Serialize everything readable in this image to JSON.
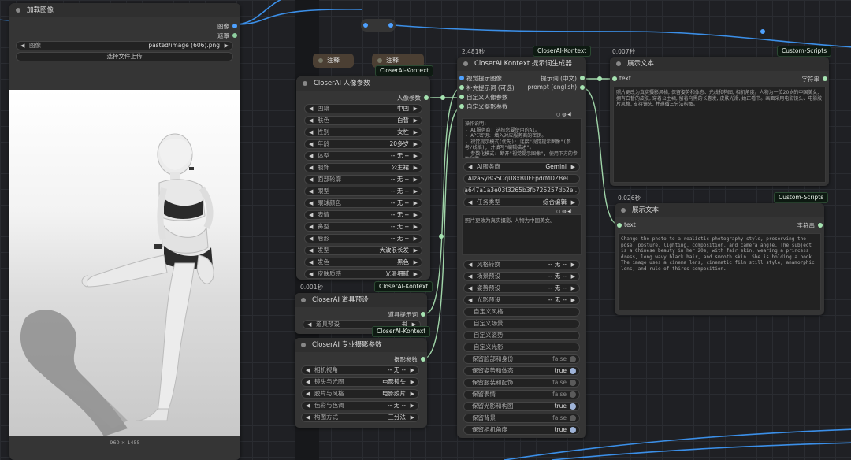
{
  "load_image": {
    "title": "加载图像",
    "out_image": "图像",
    "out_mask": "遮罩",
    "image_label": "图像",
    "image_value": "pasted/image (606).png",
    "upload_button": "选择文件上传",
    "image_size": "960 × 1455"
  },
  "reroute_dots": [
    "•",
    "•"
  ],
  "notes": [
    "注释",
    "注释"
  ],
  "portrait_node": {
    "badge": "CloserAI-Kontext",
    "title": "CloserAI 人像参数",
    "output": "人像参数",
    "params": [
      {
        "label": "国籍",
        "value": "中国"
      },
      {
        "label": "肤色",
        "value": "白皙"
      },
      {
        "label": "性别",
        "value": "女性"
      },
      {
        "label": "年龄",
        "value": "20多岁"
      },
      {
        "label": "体型",
        "value": "-- 无 --"
      },
      {
        "label": "服饰",
        "value": "公主裙"
      },
      {
        "label": "面部轮廓",
        "value": "-- 无 --"
      },
      {
        "label": "眼型",
        "value": "-- 无 --"
      },
      {
        "label": "眼球颜色",
        "value": "-- 无 --"
      },
      {
        "label": "表情",
        "value": "-- 无 --"
      },
      {
        "label": "鼻型",
        "value": "-- 无 --"
      },
      {
        "label": "唇形",
        "value": "-- 无 --"
      },
      {
        "label": "发型",
        "value": "大波浪长发"
      },
      {
        "label": "发色",
        "value": "黑色"
      },
      {
        "label": "皮肤质感",
        "value": "光滑细腻"
      }
    ]
  },
  "prop_node": {
    "timing": "0.001秒",
    "badge": "CloserAI-Kontext",
    "title": "CloserAI 道具预设",
    "output": "道具提示词",
    "params": [
      {
        "label": "道具预设",
        "value": "书"
      }
    ]
  },
  "photo_node": {
    "badge": "CloserAI-Kontext",
    "title": "CloserAI 专业摄影参数",
    "output": "摄影参数",
    "params": [
      {
        "label": "相机视角",
        "value": "-- 无 --"
      },
      {
        "label": "镜头与光圈",
        "value": "电影镜头"
      },
      {
        "label": "胶片与风格",
        "value": "电影胶片"
      },
      {
        "label": "色彩与色调",
        "value": "-- 无 --"
      },
      {
        "label": "构图方式",
        "value": "三分法"
      }
    ]
  },
  "kontext_node": {
    "timing": "2.481秒",
    "badge": "CloserAI-Kontext",
    "title": "CloserAI Kontext 提示词生成器",
    "inputs": [
      "视觉提示图像",
      "补充提示词 (可选)",
      "自定义人像参数",
      "自定义摄影参数"
    ],
    "outputs": [
      "提示词 (中文)",
      "prompt (english)"
    ],
    "instructions": "操作说明:\n- AI服务商: 选择您要使用的AI。\n- API密钥: 填入对应服务商的密钥。\n- 视觉提示模式(优先): 连接\"视觉提示图像\"(参考/线稿), 并填写\"编辑描述\"。\n- 参数化模式: 断开\"视觉提示图像\", 使用下方的参数配置。",
    "provider": {
      "label": "AI服务商",
      "value": "Gemini"
    },
    "api_key": "AIzaSyBG5OqU8xBUFFpdrMDZBeL...",
    "session_id": "a647a1a3e03f3265b3fb726257db2e...",
    "task_type": {
      "label": "任务类型",
      "value": "综合编辑"
    },
    "edit_text": "照片更改为真实摄影, 人物为中国美女。",
    "dropdowns": [
      {
        "label": "风格转换",
        "value": "-- 无 --"
      },
      {
        "label": "场景预设",
        "value": "-- 无 --"
      },
      {
        "label": "姿势预设",
        "value": "-- 无 --"
      },
      {
        "label": "光影预设",
        "value": "-- 无 --"
      }
    ],
    "custom_fields": [
      "自定义风格",
      "自定义场景",
      "自定义姿势",
      "自定义光影"
    ],
    "toggles": [
      {
        "label": "保留脸部和身份",
        "value": "false"
      },
      {
        "label": "保留姿势和体态",
        "value": "true"
      },
      {
        "label": "保留服装和配饰",
        "value": "false"
      },
      {
        "label": "保留表情",
        "value": "false"
      },
      {
        "label": "保留光影和构图",
        "value": "true"
      },
      {
        "label": "保留背景",
        "value": "false"
      },
      {
        "label": "保留相机角度",
        "value": "true"
      }
    ]
  },
  "show_text_1": {
    "timing": "0.007秒",
    "badge": "Custom-Scripts",
    "title": "展示文本",
    "input": "text",
    "output": "字符串",
    "text": "照片更改为真实摄影风格, 保留姿势和体态、光线和构图, 相机角度。人物为一位20岁的中国美女, 拥有白皙的皮肤, 穿着公主裙, 留着乌黑的长卷发, 皮肤光滑, 她正看书。画面采用电影镜头、电影胶片风格, 支持镜头, 并遵循三分法构图。"
  },
  "show_text_2": {
    "timing": "0.026秒",
    "badge": "Custom-Scripts",
    "title": "展示文本",
    "input": "text",
    "output": "字符串",
    "text": "Change the photo to a realistic photography style, preserving the pose, posture, lighting, composition, and camera angle. The subject is a Chinese beauty in her 20s, with fair skin, wearing a princess dress, long wavy black hair, and smooth skin. She is holding a book. The image uses a cinema lens, cinematic film still style, anamorphic lens, and rule of thirds composition."
  },
  "colors": {
    "wire_blue": "#3b8fe8",
    "wire_green": "#9fd4a8",
    "pin_blue": "#4ea1ff",
    "pin_green": "#a6e3b1"
  }
}
